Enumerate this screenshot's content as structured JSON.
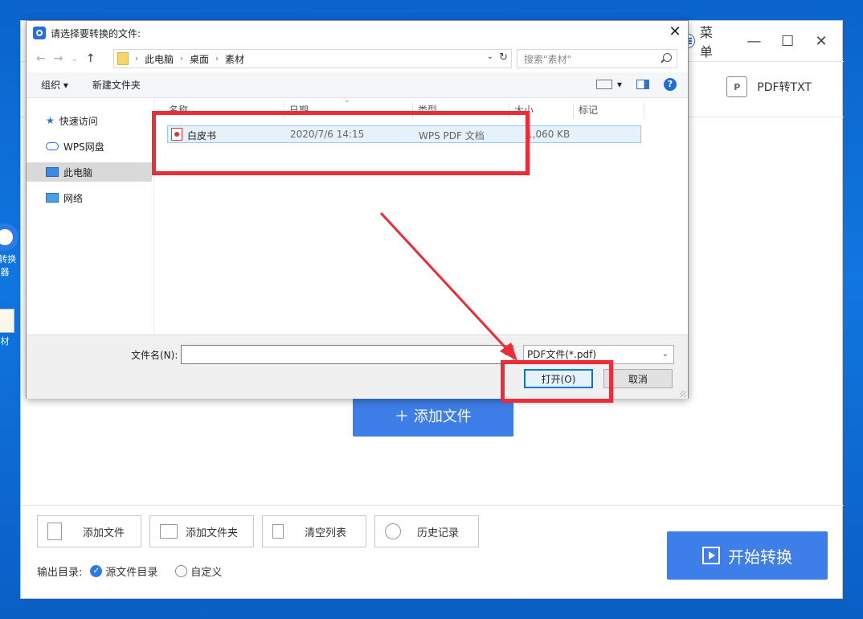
{
  "desktop": {
    "icons": [
      {
        "label": "F转换",
        "label2": "器",
        "icon": "app-icon"
      },
      {
        "label": "材",
        "label2": "",
        "icon": "file-icon"
      }
    ]
  },
  "app": {
    "menu_label": "菜单",
    "minimize_symbol": "—",
    "maximize_symbol": "☐",
    "close_symbol": "✕",
    "tab_pdf_txt": "PDF转TXT",
    "tab_pdf_txt_icon_text": "P",
    "add_file_big": "＋ 添加文件",
    "toolbar": {
      "add_file": "添加文件",
      "add_folder": "添加文件夹",
      "clear_list": "清空列表",
      "history": "历史记录"
    },
    "output_dir_label": "输出目录:",
    "output_options": [
      {
        "label": "源文件目录",
        "selected": true
      },
      {
        "label": "自定义",
        "selected": false
      }
    ],
    "start_button": "开始转换",
    "accent": "#3d7ee8"
  },
  "dialog": {
    "title": "请选择要转换的文件:",
    "close_symbol": "✕",
    "nav": {
      "back": "←",
      "forward": "→",
      "recent": "⌄",
      "up": "↑"
    },
    "breadcrumb": [
      "此电脑",
      "桌面",
      "素材"
    ],
    "refresh_symbol": "↻",
    "search_placeholder": "搜索\"素材\"",
    "commands": {
      "organize": "组织 ▾",
      "new_folder": "新建文件夹"
    },
    "view_menu_caret": "▾",
    "help_symbol": "?",
    "nav_pane": [
      {
        "label": "快速访问",
        "icon": "star-icon",
        "selected": false
      },
      {
        "label": "WPS网盘",
        "icon": "cloud-icon",
        "selected": false
      },
      {
        "label": "此电脑",
        "icon": "computer-icon",
        "selected": true
      },
      {
        "label": "网络",
        "icon": "network-icon",
        "selected": false
      }
    ],
    "columns": [
      "名称",
      "日期",
      "类型",
      "大小",
      "标记"
    ],
    "sort_caret": "⌄",
    "files": [
      {
        "name": "白皮书",
        "date": "2020/7/6 14:15",
        "type": "WPS PDF 文档",
        "size": "1,060 KB"
      }
    ],
    "filename_label": "文件名(N):",
    "filename_value": "",
    "filetype_value": "PDF文件(*.pdf)",
    "dropdown_caret": "⌄",
    "open_button": "打开(O)",
    "cancel_button": "取消"
  },
  "annotation_color": "#ee2b36"
}
